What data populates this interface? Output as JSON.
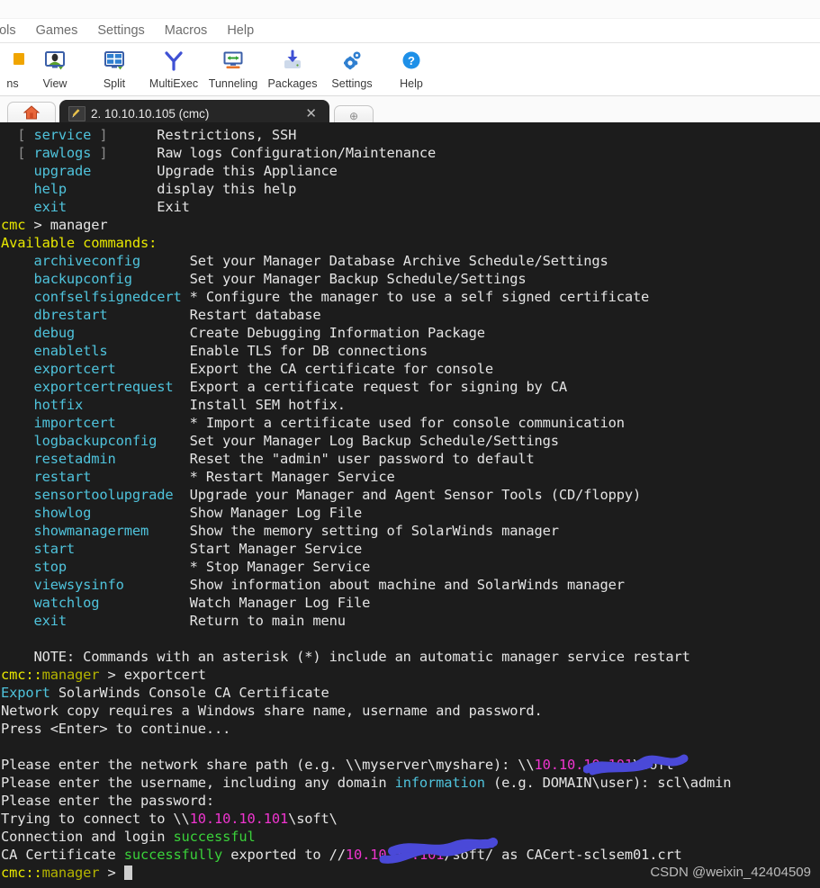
{
  "menubar": {
    "items": [
      {
        "label": "ools",
        "name": "menu-tools"
      },
      {
        "label": "Games",
        "name": "menu-games"
      },
      {
        "label": "Settings",
        "name": "menu-settings"
      },
      {
        "label": "Macros",
        "name": "menu-macros"
      },
      {
        "label": "Help",
        "name": "menu-help"
      }
    ]
  },
  "toolbar": {
    "items": [
      {
        "label": "ns",
        "icon": "sessions-icon"
      },
      {
        "label": "View",
        "icon": "view-icon"
      },
      {
        "label": "Split",
        "icon": "split-icon"
      },
      {
        "label": "MultiExec",
        "icon": "multiexec-icon"
      },
      {
        "label": "Tunneling",
        "icon": "tunneling-icon"
      },
      {
        "label": "Packages",
        "icon": "packages-icon"
      },
      {
        "label": "Settings",
        "icon": "settings-gear-icon"
      },
      {
        "label": "Help",
        "icon": "help-question-icon"
      }
    ]
  },
  "tabs": {
    "home_icon": "home-icon",
    "terminal_tab": {
      "label": "2. 10.10.10.105 (cmc)",
      "icon": "terminal-pen-icon",
      "close_label": "✕"
    },
    "new_tab_label": "⊕"
  },
  "terminal": {
    "lines": [
      {
        "segments": [
          {
            "t": "  [ ",
            "c": "gray"
          },
          {
            "t": "service",
            "c": "cmd"
          },
          {
            "t": " ]      ",
            "c": "gray"
          },
          {
            "t": "Restrictions, SSH",
            "c": "white"
          }
        ]
      },
      {
        "segments": [
          {
            "t": "  [ ",
            "c": "gray"
          },
          {
            "t": "rawlogs",
            "c": "cmd"
          },
          {
            "t": " ]      ",
            "c": "gray"
          },
          {
            "t": "Raw logs Configuration/Maintenance",
            "c": "white"
          }
        ]
      },
      {
        "segments": [
          {
            "t": "    ",
            "c": "white"
          },
          {
            "t": "upgrade",
            "c": "cmd"
          },
          {
            "t": "        ",
            "c": "white"
          },
          {
            "t": "Upgrade this Appliance",
            "c": "white"
          }
        ]
      },
      {
        "segments": [
          {
            "t": "    ",
            "c": "white"
          },
          {
            "t": "help",
            "c": "cmd"
          },
          {
            "t": "           ",
            "c": "white"
          },
          {
            "t": "display this help",
            "c": "white"
          }
        ]
      },
      {
        "segments": [
          {
            "t": "    ",
            "c": "white"
          },
          {
            "t": "exit",
            "c": "cmd"
          },
          {
            "t": "           ",
            "c": "white"
          },
          {
            "t": "Exit",
            "c": "white"
          }
        ]
      },
      {
        "segments": [
          {
            "t": "cmc",
            "c": "yellow"
          },
          {
            "t": " > manager",
            "c": "white"
          }
        ]
      },
      {
        "segments": [
          {
            "t": "Available commands:",
            "c": "yellow"
          }
        ]
      },
      {
        "segments": [
          {
            "t": "    ",
            "c": "white"
          },
          {
            "t": "archiveconfig",
            "c": "cmd"
          },
          {
            "t": "      Set your Manager Database Archive Schedule/Settings",
            "c": "white"
          }
        ]
      },
      {
        "segments": [
          {
            "t": "    ",
            "c": "white"
          },
          {
            "t": "backupconfig",
            "c": "cmd"
          },
          {
            "t": "       Set your Manager Backup Schedule/Settings",
            "c": "white"
          }
        ]
      },
      {
        "segments": [
          {
            "t": "    ",
            "c": "white"
          },
          {
            "t": "confselfsignedcert",
            "c": "cmd"
          },
          {
            "t": " * Configure the manager to use a self signed certificate",
            "c": "white"
          }
        ]
      },
      {
        "segments": [
          {
            "t": "    ",
            "c": "white"
          },
          {
            "t": "dbrestart",
            "c": "cmd"
          },
          {
            "t": "          Restart database",
            "c": "white"
          }
        ]
      },
      {
        "segments": [
          {
            "t": "    ",
            "c": "white"
          },
          {
            "t": "debug",
            "c": "cmd"
          },
          {
            "t": "              Create Debugging Information Package",
            "c": "white"
          }
        ]
      },
      {
        "segments": [
          {
            "t": "    ",
            "c": "white"
          },
          {
            "t": "enabletls",
            "c": "cmd"
          },
          {
            "t": "          Enable TLS for DB connections",
            "c": "white"
          }
        ]
      },
      {
        "segments": [
          {
            "t": "    ",
            "c": "white"
          },
          {
            "t": "exportcert",
            "c": "cmd"
          },
          {
            "t": "         Export the CA certificate for console",
            "c": "white"
          }
        ]
      },
      {
        "segments": [
          {
            "t": "    ",
            "c": "white"
          },
          {
            "t": "exportcertrequest",
            "c": "cmd"
          },
          {
            "t": "  Export a certificate request for signing by CA",
            "c": "white"
          }
        ]
      },
      {
        "segments": [
          {
            "t": "    ",
            "c": "white"
          },
          {
            "t": "hotfix",
            "c": "cmd"
          },
          {
            "t": "             Install SEM hotfix.",
            "c": "white"
          }
        ]
      },
      {
        "segments": [
          {
            "t": "    ",
            "c": "white"
          },
          {
            "t": "importcert",
            "c": "cmd"
          },
          {
            "t": "         * Import a certificate used for console communication",
            "c": "white"
          }
        ]
      },
      {
        "segments": [
          {
            "t": "    ",
            "c": "white"
          },
          {
            "t": "logbackupconfig",
            "c": "cmd"
          },
          {
            "t": "    Set your Manager Log Backup Schedule/Settings",
            "c": "white"
          }
        ]
      },
      {
        "segments": [
          {
            "t": "    ",
            "c": "white"
          },
          {
            "t": "resetadmin",
            "c": "cmd"
          },
          {
            "t": "         Reset the \"admin\" user password to default",
            "c": "white"
          }
        ]
      },
      {
        "segments": [
          {
            "t": "    ",
            "c": "white"
          },
          {
            "t": "restart",
            "c": "cmd"
          },
          {
            "t": "            * Restart Manager Service",
            "c": "white"
          }
        ]
      },
      {
        "segments": [
          {
            "t": "    ",
            "c": "white"
          },
          {
            "t": "sensortoolupgrade",
            "c": "cmd"
          },
          {
            "t": "  Upgrade your Manager and Agent Sensor Tools (CD/floppy)",
            "c": "white"
          }
        ]
      },
      {
        "segments": [
          {
            "t": "    ",
            "c": "white"
          },
          {
            "t": "showlog",
            "c": "cmd"
          },
          {
            "t": "            Show Manager Log File",
            "c": "white"
          }
        ]
      },
      {
        "segments": [
          {
            "t": "    ",
            "c": "white"
          },
          {
            "t": "showmanagermem",
            "c": "cmd"
          },
          {
            "t": "     Show the memory setting of SolarWinds manager",
            "c": "white"
          }
        ]
      },
      {
        "segments": [
          {
            "t": "    ",
            "c": "white"
          },
          {
            "t": "start",
            "c": "cmd"
          },
          {
            "t": "              Start Manager Service",
            "c": "white"
          }
        ]
      },
      {
        "segments": [
          {
            "t": "    ",
            "c": "white"
          },
          {
            "t": "stop",
            "c": "cmd"
          },
          {
            "t": "               * Stop Manager Service",
            "c": "white"
          }
        ]
      },
      {
        "segments": [
          {
            "t": "    ",
            "c": "white"
          },
          {
            "t": "viewsysinfo",
            "c": "cmd"
          },
          {
            "t": "        Show information about machine and SolarWinds manager",
            "c": "white"
          }
        ]
      },
      {
        "segments": [
          {
            "t": "    ",
            "c": "white"
          },
          {
            "t": "watchlog",
            "c": "cmd"
          },
          {
            "t": "           Watch Manager Log File",
            "c": "white"
          }
        ]
      },
      {
        "segments": [
          {
            "t": "    ",
            "c": "white"
          },
          {
            "t": "exit",
            "c": "cmd"
          },
          {
            "t": "               Return to main menu",
            "c": "white"
          }
        ]
      },
      {
        "segments": [
          {
            "t": "",
            "c": "white"
          }
        ]
      },
      {
        "segments": [
          {
            "t": "    NOTE: Commands with an asterisk (*) include an automatic manager service restart",
            "c": "white"
          }
        ]
      },
      {
        "segments": [
          {
            "t": "cmc::",
            "c": "yellow"
          },
          {
            "t": "manager",
            "c": "olive"
          },
          {
            "t": " > exportcert",
            "c": "white"
          }
        ]
      },
      {
        "segments": [
          {
            "t": "Export",
            "c": "cmd"
          },
          {
            "t": " SolarWinds Console CA Certificate",
            "c": "white"
          }
        ]
      },
      {
        "segments": [
          {
            "t": "Network copy requires a Windows share name, username and password.",
            "c": "white"
          }
        ]
      },
      {
        "segments": [
          {
            "t": "Press <Enter> to continue...",
            "c": "white"
          }
        ]
      },
      {
        "segments": [
          {
            "t": "",
            "c": "white"
          }
        ]
      },
      {
        "segments": [
          {
            "t": "Please enter the network share path (e.g. \\\\myserver\\myshare): \\\\",
            "c": "white"
          },
          {
            "t": "10.10.10.101",
            "c": "pink"
          },
          {
            "t": "\\soft",
            "c": "white"
          }
        ]
      },
      {
        "segments": [
          {
            "t": "Please enter the username, including any domain ",
            "c": "white"
          },
          {
            "t": "information",
            "c": "cmd"
          },
          {
            "t": " (e.g. DOMAIN\\user): scl\\admin",
            "c": "white"
          }
        ]
      },
      {
        "segments": [
          {
            "t": "Please enter the password:",
            "c": "white"
          }
        ]
      },
      {
        "segments": [
          {
            "t": "Trying to connect to \\\\",
            "c": "white"
          },
          {
            "t": "10.10.10.101",
            "c": "pink"
          },
          {
            "t": "\\soft\\",
            "c": "white"
          }
        ]
      },
      {
        "segments": [
          {
            "t": "Connection and login ",
            "c": "white"
          },
          {
            "t": "successful",
            "c": "green"
          }
        ]
      },
      {
        "segments": [
          {
            "t": "CA Certificate ",
            "c": "white"
          },
          {
            "t": "successfully",
            "c": "green"
          },
          {
            "t": " exported to //",
            "c": "white"
          },
          {
            "t": "10.10.10.101",
            "c": "pink"
          },
          {
            "t": "/soft/ as CACert-sclsem01.crt",
            "c": "white"
          }
        ]
      },
      {
        "segments": [
          {
            "t": "cmc::",
            "c": "yellow"
          },
          {
            "t": "manager",
            "c": "olive"
          },
          {
            "t": " > ",
            "c": "white"
          },
          {
            "t": "CURSOR",
            "c": "cursor"
          }
        ]
      }
    ],
    "colors": {
      "background": "#1c1c1c",
      "command": "#4fc3dc",
      "text": "#e4e4e4",
      "prompt": "#e8e800",
      "prompt_context": "#b4b400",
      "success": "#3ad13a",
      "address": "#ef35cf",
      "redaction": "#4a49d8"
    }
  },
  "watermark": {
    "text": "CSDN @weixin_42404509"
  }
}
